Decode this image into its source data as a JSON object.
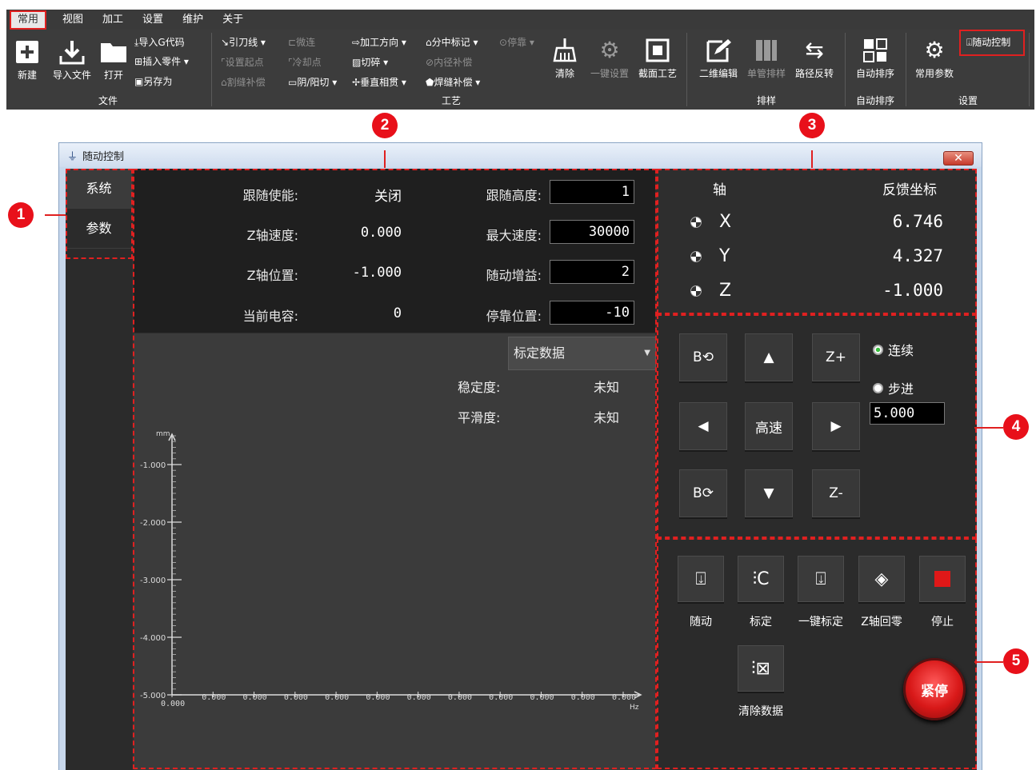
{
  "menu": {
    "items": [
      {
        "label": "常用"
      },
      {
        "label": "视图"
      },
      {
        "label": "加工"
      },
      {
        "label": "设置"
      },
      {
        "label": "维护"
      },
      {
        "label": "关于"
      }
    ]
  },
  "ribbon": {
    "file": {
      "new": "新建",
      "import_file": "导入文件",
      "open": "打开",
      "import_gcode": "导入G代码",
      "insert_part": "插入零件",
      "save_as": "另存为",
      "group": "文件"
    },
    "process": {
      "lead_line": "引刀线",
      "micro_joint": "微连",
      "set_start": "设置起点",
      "cool_point": "冷却点",
      "kerf_comp": "割缝补偿",
      "yin_yang": "阴/阳切",
      "direction": "加工方向",
      "chop": "切碎",
      "vertical": "垂直相贯",
      "mid_mark": "分中标记",
      "inner_comp": "内径补偿",
      "weld_comp": "焊缝补偿",
      "dock": "停靠",
      "clear": "清除",
      "one_click": "一键设置",
      "section": "截面工艺",
      "group": "工艺"
    },
    "nesting": {
      "edit2d": "二维编辑",
      "single": "单管排样",
      "reverse": "路径反转",
      "group": "排样"
    },
    "auto_sort": {
      "label": "自动排序",
      "group": "自动排序"
    },
    "settings": {
      "common": "常用参数",
      "follow": "随动控制",
      "group": "设置"
    }
  },
  "callouts": [
    "1",
    "2",
    "3",
    "4",
    "5"
  ],
  "window": {
    "title": "随动控制",
    "close": "✕",
    "tabs": [
      {
        "label": "系统"
      },
      {
        "label": "参数"
      }
    ]
  },
  "params": {
    "rows": [
      {
        "label": "跟随使能:",
        "value": "关闭",
        "label2": "跟随高度:",
        "input": "1"
      },
      {
        "label": "Z轴速度:",
        "value": "0.000",
        "label2": "最大速度:",
        "input": "30000"
      },
      {
        "label": "Z轴位置:",
        "value": "-1.000",
        "label2": "随动增益:",
        "input": "2"
      },
      {
        "label": "当前电容:",
        "value": "0",
        "label2": "停靠位置:",
        "input": "-10"
      }
    ]
  },
  "chart_data": {
    "type": "line",
    "title": "",
    "xlabel": "Hz",
    "ylabel": "mm",
    "x_tick_labels": [
      "0.000",
      "0.000",
      "0.000",
      "0.000",
      "0.000",
      "0.000",
      "0.000",
      "0.000",
      "0.000",
      "0.000",
      "0.000",
      "0.000"
    ],
    "y_tick_labels": [
      "-1.000",
      "-2.000",
      "-3.000",
      "-4.000",
      "-5.000"
    ],
    "yticks": [
      -1,
      -2,
      -3,
      -4,
      -5
    ],
    "ylim": [
      -5,
      -0.5
    ],
    "series": []
  },
  "chart_panel": {
    "dropdown": "标定数据",
    "stability_label": "稳定度:",
    "stability_value": "未知",
    "smoothness_label": "平滑度:",
    "smoothness_value": "未知"
  },
  "axes": {
    "header_axis": "轴",
    "header_coord": "反馈坐标",
    "rows": [
      {
        "axis": "X",
        "value": "6.746"
      },
      {
        "axis": "Y",
        "value": "4.327"
      },
      {
        "axis": "Z",
        "value": "-1.000"
      }
    ]
  },
  "jog": {
    "b_ccw": "B⟲",
    "up": "▲",
    "z_plus": "Z+",
    "left": "◀",
    "high_speed": "高速",
    "right": "▶",
    "b_cw": "B⟳",
    "down": "▼",
    "z_minus": "Z-",
    "continuous": "连续",
    "step": "步进",
    "step_value": "5.000"
  },
  "ops": {
    "follow": "随动",
    "calibrate": "标定",
    "one_key_calibrate": "一键标定",
    "z_home": "Z轴回零",
    "stop": "停止",
    "clear_data": "清除数据",
    "estop": "紧停"
  },
  "colors": {
    "accent_red": "#e02020",
    "panel_dark": "#2e2e2e",
    "estop": "#d81818"
  }
}
